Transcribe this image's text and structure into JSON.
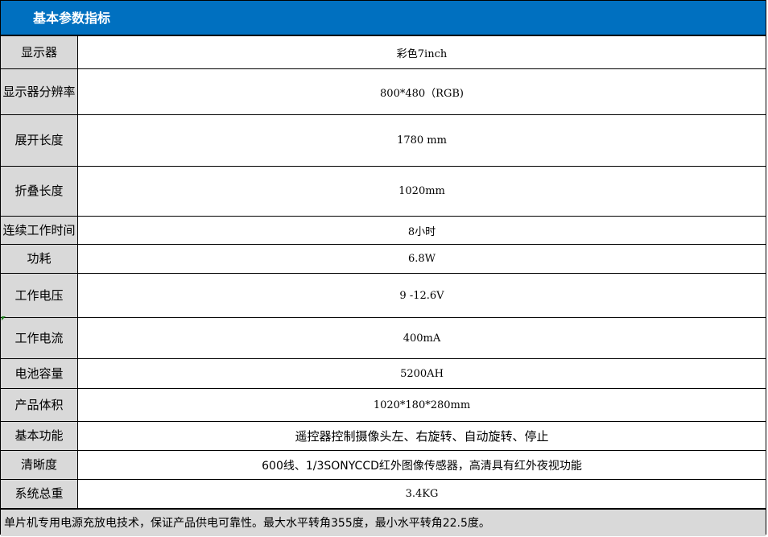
{
  "title": "基本参数指标",
  "rows": [
    {
      "label": "显示器",
      "value": "彩色7inch"
    },
    {
      "label": "显示器分辨率",
      "value": "800*480（RGB)"
    },
    {
      "label": "展开长度",
      "value": "1780 mm"
    },
    {
      "label": "折叠长度",
      "value": "1020mm"
    },
    {
      "label": "连续工作时间",
      "value": "8小时"
    },
    {
      "label": "功耗",
      "value": "6.8W"
    },
    {
      "label": "工作电压",
      "value": "9 -12.6V"
    },
    {
      "label": "工作电流",
      "value": "400mA"
    },
    {
      "label": "电池容量",
      "value": "5200AH"
    },
    {
      "label": "产品体积",
      "value": "1020*180*280mm"
    },
    {
      "label": "基本功能",
      "value": "遥控器控制摄像头左、右旋转、自动旋转、停止"
    },
    {
      "label": "清晰度",
      "value": "600线、1/3SONYCCD红外图像传感器，高清具有红外夜视功能"
    },
    {
      "label": "系统总重",
      "value": "3.4KG"
    }
  ],
  "note": "单片机专用电源充放电技术，保证产品供电可靠性。最大水平转角355度，最小水平转角22.5度。"
}
